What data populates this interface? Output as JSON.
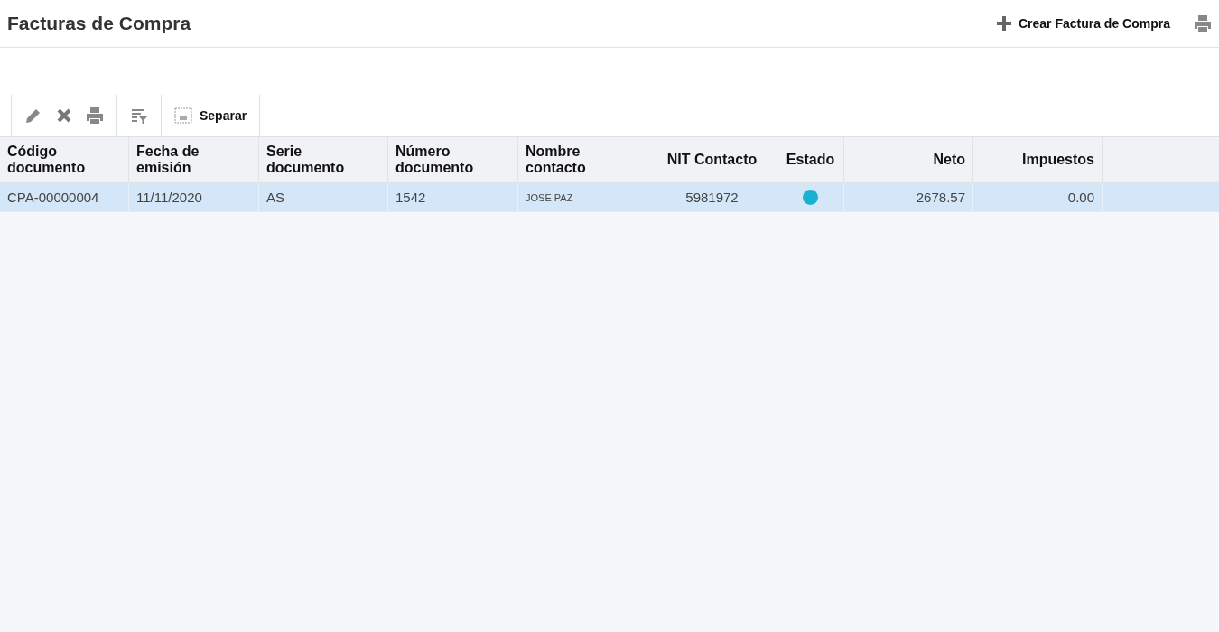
{
  "header": {
    "title": "Facturas de Compra",
    "create_button": "Crear Factura de Compra"
  },
  "toolbar": {
    "separate_button": "Separar"
  },
  "table": {
    "columns": [
      "Código documento",
      "Fecha de emisión",
      "Serie documento",
      "Número documento",
      "Nombre contacto",
      "NIT Contacto",
      "Estado",
      "Neto",
      "Impuestos"
    ],
    "rows": [
      {
        "selected": true,
        "color": "#1ab0d0",
        "cells": [
          "CPA-00000004",
          "11/11/2020",
          "AS",
          "1542",
          "JOSE PAZ",
          "5981972",
          "",
          "2678.57",
          "0.00"
        ]
      }
    ]
  }
}
